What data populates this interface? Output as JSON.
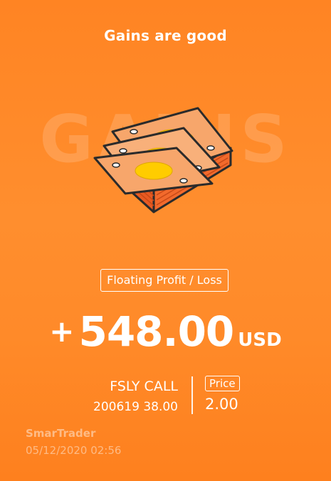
{
  "title": "Gains are good",
  "background_word": "GAINS",
  "illustration": {
    "icon": "money-stack-icon"
  },
  "badge": "Floating Profit / Loss",
  "profit": {
    "sign": "+",
    "amount": "548.00",
    "currency": "USD"
  },
  "contract": {
    "name": "FSLY CALL",
    "detail": "200619 38.00"
  },
  "price": {
    "label": "Price",
    "value": "2.00"
  },
  "footer": {
    "brand": "SmarTrader",
    "timestamp": "05/12/2020 02:56"
  },
  "colors": {
    "background": "#ff8a29",
    "bill": "#f7a66b",
    "coin": "#ffcc00",
    "stack": "#f26a2c",
    "outline": "#2b2b2b"
  }
}
